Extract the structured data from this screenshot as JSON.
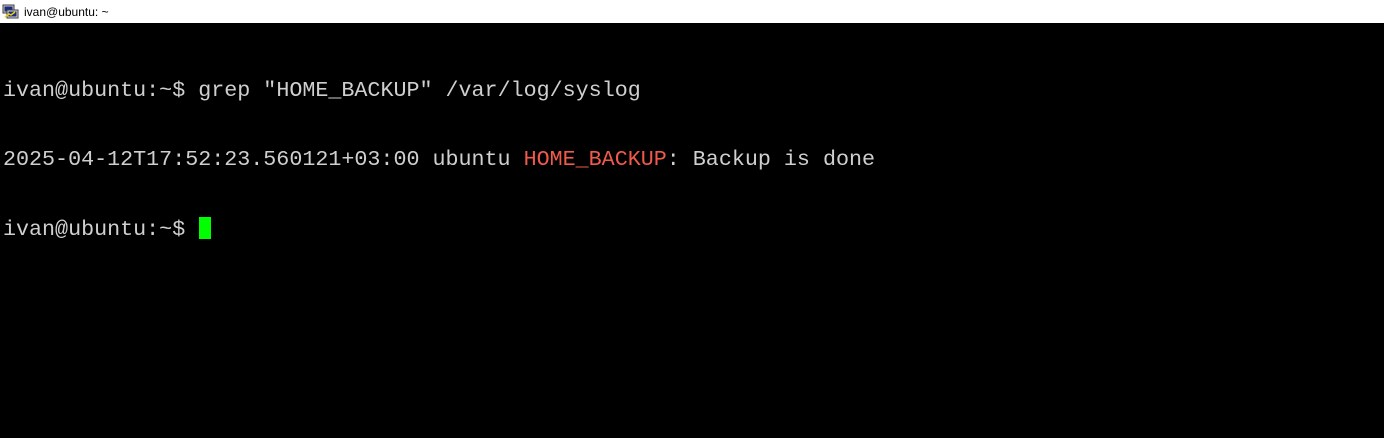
{
  "window": {
    "title": "ivan@ubuntu: ~",
    "icon": "putty-terminal-icon"
  },
  "terminal": {
    "line1": {
      "prompt": "ivan@ubuntu:~$ ",
      "command": "grep \"HOME_BACKUP\" /var/log/syslog"
    },
    "line2": {
      "prefix": "2025-04-12T17:52:23.560121+03:00 ubuntu ",
      "match": "HOME_BACKUP",
      "suffix": ": Backup is done"
    },
    "line3": {
      "prompt": "ivan@ubuntu:~$ "
    }
  },
  "colors": {
    "background": "#000000",
    "text": "#cfcfcf",
    "match": "#f05a4a",
    "cursor": "#00ff00"
  }
}
